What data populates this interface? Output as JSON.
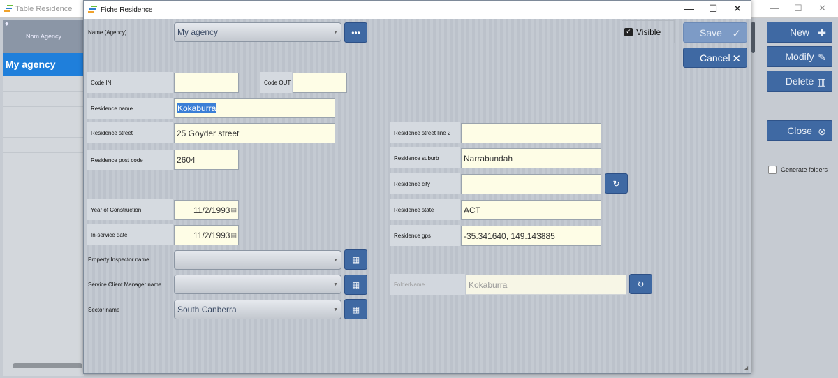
{
  "background": {
    "title": "Table Residence",
    "list_header": "Nom Agency",
    "list_selected": "My agency",
    "buttons": {
      "new": "New",
      "modify": "Modify",
      "delete": "Delete",
      "close": "Close"
    },
    "generate_folders_label": "Generate folders",
    "generate_folders_checked": false,
    "window_controls": {
      "minimize": "—",
      "maximize": "☐",
      "close": "✕"
    }
  },
  "dialog": {
    "title": "Fiche Residence",
    "window_controls": {
      "minimize": "—",
      "maximize": "☐",
      "close": "✕"
    },
    "visible_label": "Visible",
    "visible_checked": true,
    "save_label": "Save",
    "cancel_label": "Cancel",
    "fields": {
      "agency_label": "Name (Agency)",
      "agency_value": "My agency",
      "code_in_label": "Code IN",
      "code_in_value": "",
      "code_out_label": "Code OUT",
      "code_out_value": "",
      "residence_name_label": "Residence name",
      "residence_name_value": "Kokaburra",
      "street_label": "Residence street",
      "street_value": "25 Goyder street",
      "street2_label": "Residence street line 2",
      "street2_value": "",
      "post_code_label": "Residence post code",
      "post_code_value": "2604",
      "suburb_label": "Residence suburb",
      "suburb_value": "Narrabundah",
      "city_label": "Residence city",
      "city_value": "",
      "year_label": "Year of Construction",
      "year_value": "11/2/1993",
      "state_label": "Residence state",
      "state_value": "ACT",
      "inservice_label": "In-service date",
      "inservice_value": "11/2/1993",
      "gps_label": "Residence gps",
      "gps_value": "-35.341640, 149.143885",
      "inspector_label": "Property Inspector name",
      "inspector_value": "",
      "client_mgr_label": "Service Client Manager name",
      "client_mgr_value": "",
      "sector_label": "Sector name",
      "sector_value": "South Canberra",
      "folder_label": "FolderName",
      "folder_value": "Kokaburra"
    },
    "icons": {
      "more": "•••",
      "grid": "▦",
      "refresh": "↻",
      "check": "✓",
      "cross": "✕",
      "calendar": "▤"
    }
  }
}
